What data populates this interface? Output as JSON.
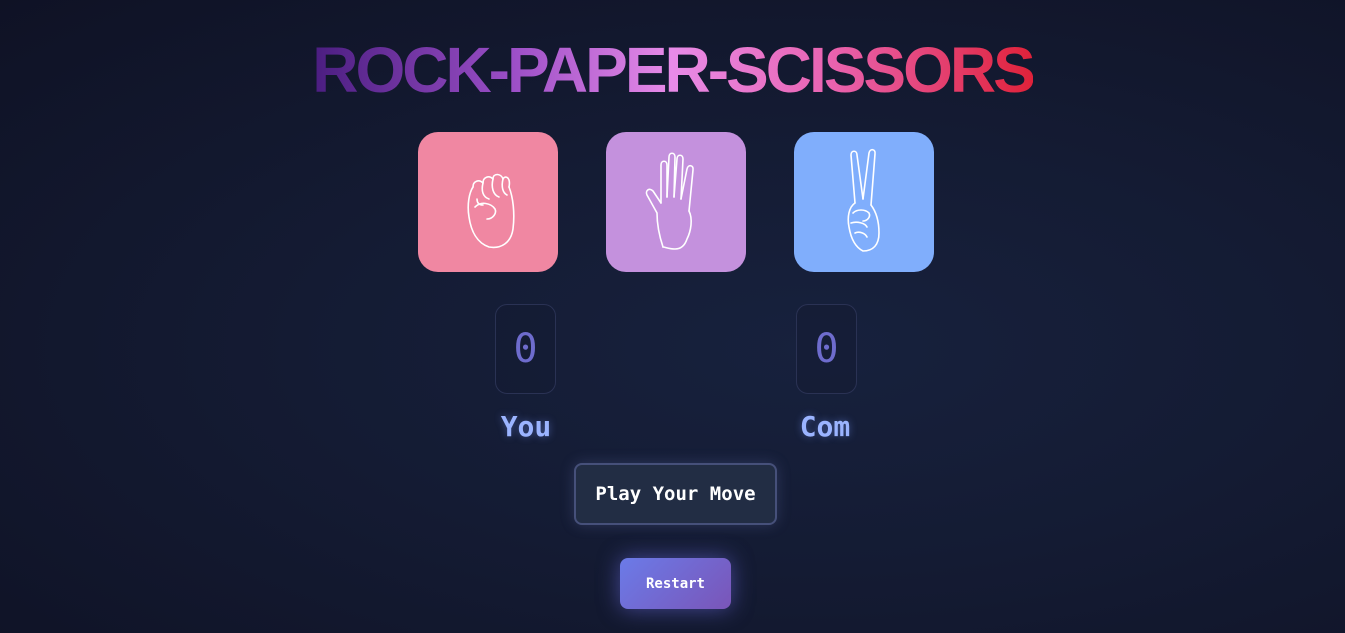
{
  "title": "ROCK-PAPER-SCISSORS",
  "choices": [
    {
      "name": "rock",
      "icon": "fist-hand-icon",
      "color": "#f087a2"
    },
    {
      "name": "paper",
      "icon": "open-hand-icon",
      "color": "#c491dd"
    },
    {
      "name": "scissors",
      "icon": "peace-hand-icon",
      "color": "#80aefc"
    }
  ],
  "scores": {
    "you": "0",
    "com": "0"
  },
  "labels": {
    "you": "You",
    "com": "Com"
  },
  "message": "Play Your Move",
  "restart_label": "Restart"
}
